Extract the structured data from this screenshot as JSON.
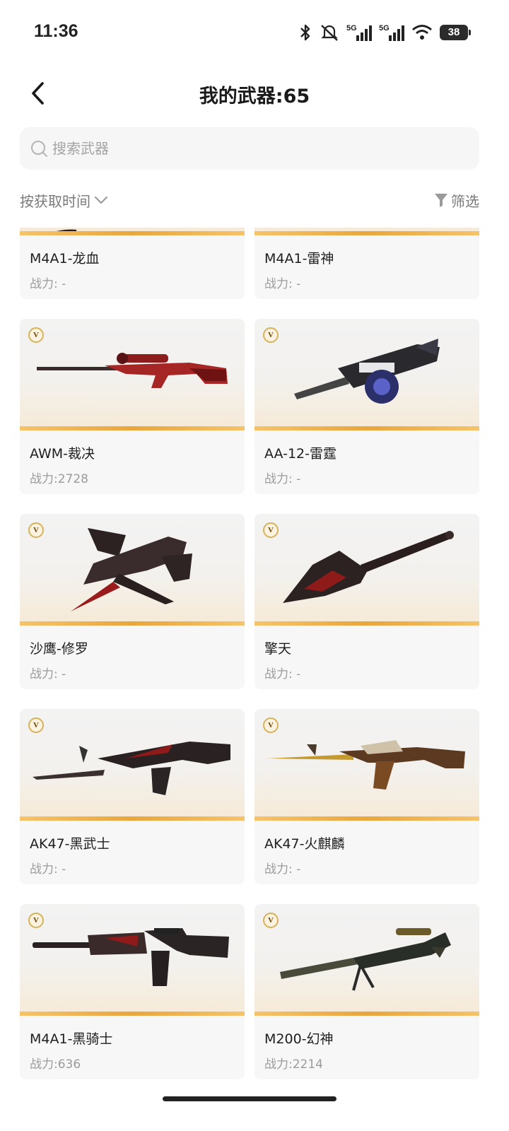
{
  "status_bar": {
    "time": "11:36",
    "network_label_1": "5G",
    "network_label_2": "5G",
    "battery": "38"
  },
  "header": {
    "title": "我的武器:65"
  },
  "search": {
    "placeholder": "搜索武器"
  },
  "sort": {
    "label": "按获取时间"
  },
  "filter": {
    "label": "筛选"
  },
  "weapons": [
    {
      "name": "M4A1-龙血",
      "power": "战力: -",
      "icon": "rifle-icon"
    },
    {
      "name": "M4A1-雷神",
      "power": "战力: -",
      "icon": "rifle-icon"
    },
    {
      "name": "AWM-裁决",
      "power": "战力:2728",
      "icon": "sniper-rifle-icon",
      "badge": "V"
    },
    {
      "name": "AA-12-雷霆",
      "power": "战力: -",
      "icon": "shotgun-drum-icon",
      "badge": "V"
    },
    {
      "name": "沙鹰-修罗",
      "power": "战力: -",
      "icon": "pistol-blade-icon",
      "badge": "V"
    },
    {
      "name": "擎天",
      "power": "战力: -",
      "icon": "shovel-icon",
      "badge": "V"
    },
    {
      "name": "AK47-黑武士",
      "power": "战力: -",
      "icon": "rifle-bayonet-icon",
      "badge": "V"
    },
    {
      "name": "AK47-火麒麟",
      "power": "战力: -",
      "icon": "rifle-gold-icon",
      "badge": "V"
    },
    {
      "name": "M4A1-黑骑士",
      "power": "战力:636",
      "icon": "rifle-icon",
      "badge": "V"
    },
    {
      "name": "M200-幻神",
      "power": "战力:2214",
      "icon": "sniper-bipod-icon",
      "badge": "V"
    }
  ],
  "colors": {
    "accent_stripe": "#e9a63c",
    "card_bg": "#f7f7f7",
    "muted_text": "#9b9b9b"
  }
}
